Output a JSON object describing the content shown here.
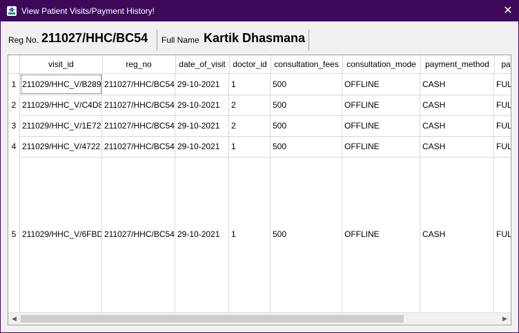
{
  "window": {
    "title": "View Patient Visits/Payment History!",
    "close_glyph": "✕"
  },
  "header": {
    "reg_label": "Reg No.",
    "reg_value": "211027/HHC/BC54",
    "name_label": "Full Name",
    "name_value": "Kartik Dhasmana"
  },
  "table": {
    "columns": [
      "visit_id",
      "reg_no",
      "date_of_visit",
      "doctor_id",
      "consultation_fees",
      "consultation_mode",
      "payment_method",
      "pay"
    ],
    "rows": [
      {
        "num": "1",
        "cells": [
          "211029/HHC_V/B289",
          "211027/HHC/BC54",
          "29-10-2021",
          "1",
          "500",
          "OFFLINE",
          "CASH",
          "FUL"
        ]
      },
      {
        "num": "2",
        "cells": [
          "211029/HHC_V/C4D8",
          "211027/HHC/BC54",
          "29-10-2021",
          "2",
          "500",
          "OFFLINE",
          "CASH",
          "FUL"
        ]
      },
      {
        "num": "3",
        "cells": [
          "211029/HHC_V/1E72",
          "211027/HHC/BC54",
          "29-10-2021",
          "2",
          "500",
          "OFFLINE",
          "CASH",
          "FUL"
        ]
      },
      {
        "num": "4",
        "cells": [
          "211029/HHC_V/4722",
          "211027/HHC/BC54",
          "29-10-2021",
          "1",
          "500",
          "OFFLINE",
          "CASH",
          "FUL"
        ]
      },
      {
        "num": "5",
        "cells": [
          "211029/HHC_V/6FBD",
          "211027/HHC/BC54",
          "29-10-2021",
          "1",
          "500",
          "OFFLINE",
          "CASH",
          "FUL"
        ]
      }
    ],
    "selected_row": 0,
    "selected_col": 0
  },
  "scrollbar": {
    "left_arrow": "◀",
    "right_arrow": "▶",
    "position": 0
  },
  "colors": {
    "titlebar": "#3d0a5a",
    "grid": "#d8d8d8"
  }
}
